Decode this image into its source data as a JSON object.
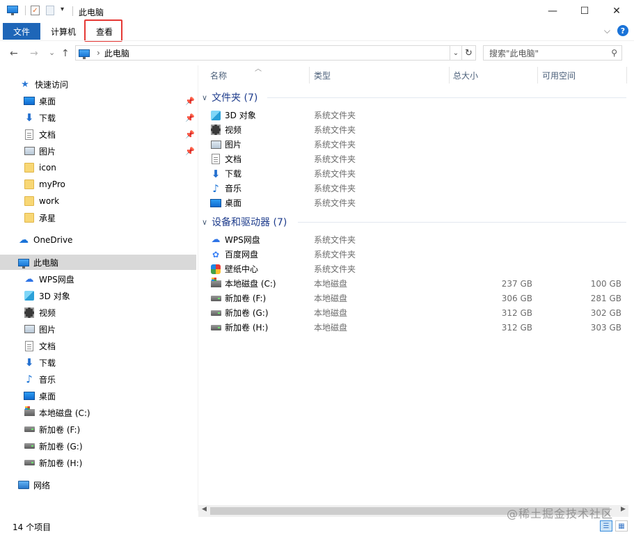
{
  "window": {
    "title": "此电脑",
    "minimize_glyph": "—",
    "maximize_glyph": "☐",
    "close_glyph": "✕"
  },
  "ribbon": {
    "tabs": [
      "文件",
      "计算机",
      "查看"
    ],
    "help_glyph": "?",
    "expand_glyph": "⌵",
    "accent": "#1e66b8",
    "highlight_color": "#e53935"
  },
  "address": {
    "back_glyph": "←",
    "forward_glyph": "→",
    "recent_glyph": "⌄",
    "up_glyph": "↑",
    "separator": "›",
    "path": "此电脑",
    "search_placeholder": "搜索\"此电脑\""
  },
  "nav": {
    "quick_access": "快速访问",
    "quick_items": [
      {
        "label": "桌面",
        "icon": "desktop-icon",
        "pinned": true
      },
      {
        "label": "下载",
        "icon": "download-icon",
        "pinned": true
      },
      {
        "label": "文档",
        "icon": "document-icon",
        "pinned": true
      },
      {
        "label": "图片",
        "icon": "picture-icon",
        "pinned": true
      },
      {
        "label": "icon",
        "icon": "folder-icon",
        "pinned": false
      },
      {
        "label": "myPro",
        "icon": "folder-icon",
        "pinned": false
      },
      {
        "label": "work",
        "icon": "folder-icon",
        "pinned": false
      },
      {
        "label": "承星",
        "icon": "folder-icon",
        "pinned": false
      }
    ],
    "onedrive": "OneDrive",
    "this_pc": "此电脑",
    "pc_items": [
      {
        "label": "WPS网盘",
        "icon": "wps-cloud-icon"
      },
      {
        "label": "3D 对象",
        "icon": "3d-objects-icon"
      },
      {
        "label": "视频",
        "icon": "video-icon"
      },
      {
        "label": "图片",
        "icon": "picture-icon"
      },
      {
        "label": "文档",
        "icon": "document-icon"
      },
      {
        "label": "下载",
        "icon": "download-icon"
      },
      {
        "label": "音乐",
        "icon": "music-icon"
      },
      {
        "label": "桌面",
        "icon": "desktop-icon"
      },
      {
        "label": "本地磁盘 (C:)",
        "icon": "system-disk-icon"
      },
      {
        "label": "新加卷 (F:)",
        "icon": "disk-icon"
      },
      {
        "label": "新加卷 (G:)",
        "icon": "disk-icon"
      },
      {
        "label": "新加卷 (H:)",
        "icon": "disk-icon"
      }
    ],
    "network": "网络"
  },
  "columns": {
    "name": "名称",
    "type": "类型",
    "total": "总大小",
    "free": "可用空间"
  },
  "groups": {
    "folders": {
      "title": "文件夹 (7)",
      "items": [
        {
          "name": "3D 对象",
          "type": "系统文件夹",
          "icon": "3d-objects-icon"
        },
        {
          "name": "视频",
          "type": "系统文件夹",
          "icon": "video-icon"
        },
        {
          "name": "图片",
          "type": "系统文件夹",
          "icon": "picture-icon"
        },
        {
          "name": "文档",
          "type": "系统文件夹",
          "icon": "document-icon"
        },
        {
          "name": "下载",
          "type": "系统文件夹",
          "icon": "download-icon"
        },
        {
          "name": "音乐",
          "type": "系统文件夹",
          "icon": "music-icon"
        },
        {
          "name": "桌面",
          "type": "系统文件夹",
          "icon": "desktop-icon"
        }
      ]
    },
    "devices": {
      "title": "设备和驱动器 (7)",
      "items": [
        {
          "name": "WPS网盘",
          "type": "系统文件夹",
          "total": "",
          "free": "",
          "icon": "wps-cloud-icon"
        },
        {
          "name": "百度网盘",
          "type": "系统文件夹",
          "total": "",
          "free": "",
          "icon": "baidu-cloud-icon"
        },
        {
          "name": "壁纸中心",
          "type": "系统文件夹",
          "total": "",
          "free": "",
          "icon": "wallpaper-icon"
        },
        {
          "name": "本地磁盘 (C:)",
          "type": "本地磁盘",
          "total": "237 GB",
          "free": "100 GB",
          "icon": "system-disk-icon"
        },
        {
          "name": "新加卷 (F:)",
          "type": "本地磁盘",
          "total": "306 GB",
          "free": "281 GB",
          "icon": "disk-icon"
        },
        {
          "name": "新加卷 (G:)",
          "type": "本地磁盘",
          "total": "312 GB",
          "free": "302 GB",
          "icon": "disk-icon"
        },
        {
          "name": "新加卷 (H:)",
          "type": "本地磁盘",
          "total": "312 GB",
          "free": "303 GB",
          "icon": "disk-icon"
        }
      ]
    }
  },
  "scrollbar": {
    "left_glyph": "◀",
    "right_glyph": "▶"
  },
  "status": {
    "count": "14 个项目",
    "watermark": "@稀土掘金技术社区",
    "details_view_glyph": "☰",
    "tiles_view_glyph": "▦"
  }
}
